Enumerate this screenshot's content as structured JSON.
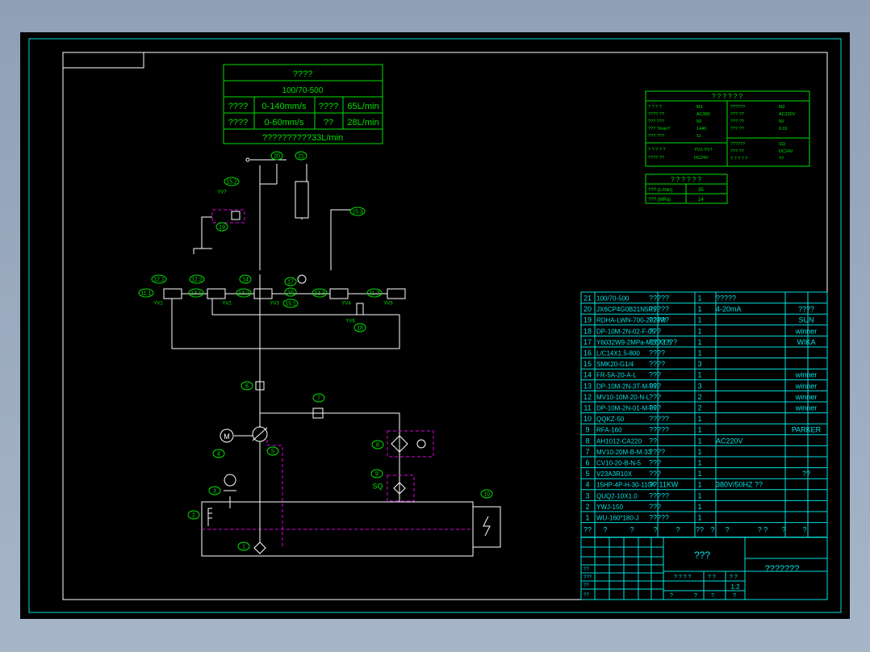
{
  "spec_table": {
    "title": "????",
    "model": "100/70-500",
    "row1": [
      "????",
      "0-140mm/s",
      "????",
      "65L/min"
    ],
    "row2": [
      "????",
      "0-60mm/s",
      "??",
      "28L/min"
    ],
    "footer": "??????????33L/min"
  },
  "small_table1": {
    "title": "? ? ? ? ? ?",
    "left": [
      [
        "? ? ? ?",
        "M1"
      ],
      [
        "???? ??",
        "AC380"
      ],
      [
        "??? ???",
        "50"
      ],
      [
        "??? ?/min?",
        "1440"
      ],
      [
        "??? ???",
        "11"
      ]
    ],
    "right": [
      [
        "??????",
        "M2"
      ],
      [
        "??? ??",
        "AC220V"
      ],
      [
        "??? ??",
        "50"
      ],
      [
        "??? ??",
        "0.01"
      ]
    ],
    "left2": [
      [
        "? ? ? ? ?",
        "YV1-YV7"
      ],
      [
        "???? ??",
        "DC24V"
      ]
    ],
    "right2": [
      [
        "??????",
        "SQ"
      ],
      [
        "??? ??",
        "DC24V"
      ],
      [
        "? ? ? ? ?",
        "??"
      ]
    ]
  },
  "small_table2": {
    "title": "? ? ? ? ? ?",
    "rows": [
      [
        "??? (L/min)",
        "35"
      ],
      [
        "??? (MPa)",
        "14"
      ]
    ]
  },
  "bom": [
    [
      "21",
      "100/70-500",
      "?????",
      "1",
      "?????",
      "",
      ""
    ],
    [
      "20",
      "JX6CP4G0B21N5R5",
      "?????",
      "1",
      "4-20mA",
      "",
      "????"
    ],
    [
      "19",
      "RDHA-LWN-700-2024W",
      "?????",
      "1",
      "",
      "",
      "SUN"
    ],
    [
      "18",
      "DP-10M-2N-02-F-05",
      "???",
      "1",
      "",
      "",
      "winner"
    ],
    [
      "17",
      "Y6032W9-2MPa-M20X1.5",
      "???????",
      "1",
      "",
      "",
      "WIKA"
    ],
    [
      "16",
      "L/C14X1.5-800",
      "????",
      "1",
      "",
      "",
      ""
    ],
    [
      "15",
      "SMK20-G1/4",
      "????",
      "3",
      "",
      "",
      ""
    ],
    [
      "14",
      "FR-5A-20-A-L",
      "???",
      "1",
      "",
      "",
      "winner"
    ],
    [
      "13",
      "DP-10M-2N-3T-M-05",
      "???",
      "3",
      "",
      "",
      "winner"
    ],
    [
      "12",
      "MV10-10M-20-N-L",
      "???",
      "2",
      "",
      "",
      "winner"
    ],
    [
      "11",
      "DP-10M-2N-01-M-05",
      "???",
      "2",
      "",
      "",
      "winner"
    ],
    [
      "10",
      "QQKZ-50",
      "?????",
      "1",
      "",
      "",
      ""
    ],
    [
      "9",
      "RFA-160",
      "?????",
      "1",
      "",
      "",
      "PARKER"
    ],
    [
      "8",
      "AH1012-CA220",
      "??",
      "1",
      "AC220V",
      "",
      ""
    ],
    [
      "7",
      "MV10-20M-B-M-33",
      "????",
      "1",
      "",
      "",
      ""
    ],
    [
      "6",
      "CV10-20-B-N-5",
      "???",
      "1",
      "",
      "",
      ""
    ],
    [
      "5",
      "V23A3R10X",
      "???",
      "1",
      "",
      "",
      "??"
    ],
    [
      "4",
      "15HP-4P-H-30-110K",
      "?? 11KW",
      "1",
      "380V/50HZ ??",
      "",
      ""
    ],
    [
      "3",
      "QUQ2-10X1.0",
      "?????",
      "1",
      "",
      "",
      ""
    ],
    [
      "2",
      "YWJ-150",
      "???",
      "1",
      "",
      "",
      ""
    ],
    [
      "1",
      "WU-160*180-J",
      "?????",
      "1",
      "",
      "",
      ""
    ]
  ],
  "bom_header": [
    "??",
    "?",
    "?",
    "?",
    "?",
    "??",
    "?",
    "?",
    "? ?",
    "?",
    "?"
  ],
  "title_block": {
    "name": "???",
    "company": "???????",
    "scale_hdr": [
      "? ? ? ?",
      "? ?",
      "? ?"
    ],
    "scale": "1:2",
    "rows": [
      "??",
      "???",
      "??",
      "??"
    ],
    "bottom": [
      "?",
      "?",
      "?",
      "?"
    ]
  },
  "callouts": [
    "20",
    "21",
    "15.2",
    "15.3",
    "19",
    "YV7",
    "12.1",
    "12.2",
    "14",
    "17",
    "16",
    "13.3",
    "11.2",
    "11.1",
    "13.1",
    "13.2",
    "15.1",
    "18",
    "YV1",
    "YV2",
    "YV3",
    "YV4",
    "YV5",
    "YV6",
    "6",
    "7",
    "8",
    "9",
    "10",
    "4",
    "5",
    "3",
    "2",
    "1",
    "SQ"
  ],
  "motor_label": "M",
  "colors": {
    "green": "#00e100",
    "cyan": "#00e1e1",
    "magenta": "#e000e0",
    "background": "#000000"
  }
}
